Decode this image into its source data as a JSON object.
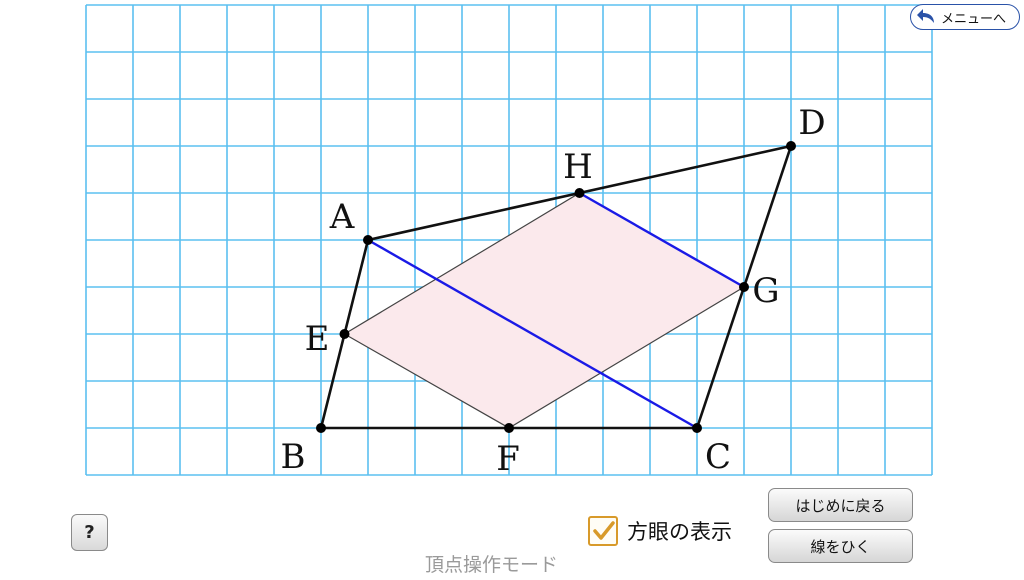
{
  "menu": {
    "label": "メニューへ",
    "icon": "back-arrow-icon"
  },
  "help": {
    "label": "?"
  },
  "grid_toggle": {
    "label": "方眼の表示",
    "checked": true
  },
  "buttons": {
    "reset": "はじめに戻る",
    "draw_line": "線をひく"
  },
  "mode_label": "頂点操作モード",
  "colors": {
    "grid": "#5bc0f0",
    "edge": "#111111",
    "diagonal": "#1a1ae6",
    "fill": "#fbe9ec",
    "checkbox_border": "#d89a2a"
  },
  "grid": {
    "columns": 18,
    "rows": 10,
    "visible": true
  },
  "points": [
    {
      "name": "A",
      "col": 6,
      "row": 5
    },
    {
      "name": "B",
      "col": 5,
      "row": 1
    },
    {
      "name": "C",
      "col": 13,
      "row": 1
    },
    {
      "name": "D",
      "col": 15,
      "row": 7
    },
    {
      "name": "E",
      "col": 5.5,
      "row": 3
    },
    {
      "name": "F",
      "col": 9,
      "row": 1
    },
    {
      "name": "G",
      "col": 14,
      "row": 4
    },
    {
      "name": "H",
      "col": 10.5,
      "row": 6
    }
  ],
  "quad_outline": [
    "A",
    "B",
    "C",
    "D"
  ],
  "inner_shape": [
    "E",
    "F",
    "G",
    "H"
  ],
  "diagonal_lines": [
    [
      "A",
      "C"
    ],
    [
      "H",
      "G"
    ]
  ]
}
